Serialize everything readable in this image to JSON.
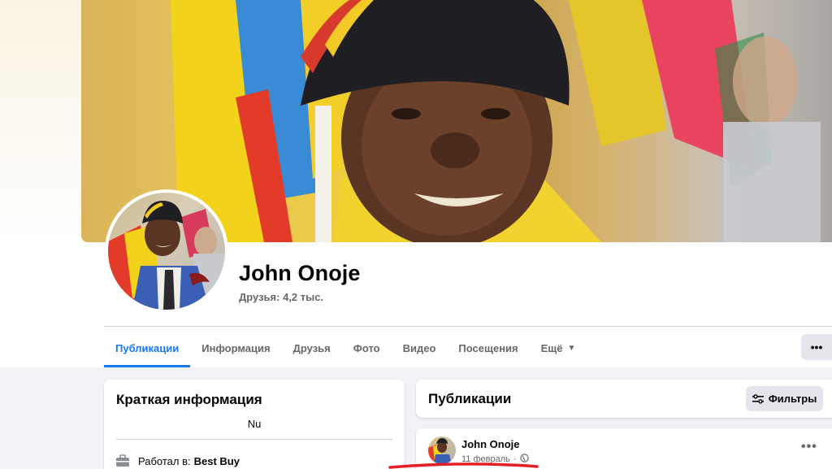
{
  "profile": {
    "name": "John Onoje",
    "friends": "Друзья: 4,2 тыс."
  },
  "tabs": [
    {
      "label": "Публикации",
      "active": true
    },
    {
      "label": "Информация"
    },
    {
      "label": "Друзья"
    },
    {
      "label": "Фото"
    },
    {
      "label": "Видео"
    },
    {
      "label": "Посещения"
    },
    {
      "label": "Ещё"
    }
  ],
  "more_button": "•••",
  "intro": {
    "title": "Краткая информация",
    "bio": "Nu",
    "work_prefix": "Работал в:",
    "work_company": "Best Buy"
  },
  "posts_header": {
    "title": "Публикации",
    "filter_label": "Фильтры"
  },
  "post": {
    "author": "John Onoje",
    "date": "11 февраль",
    "separator": "·",
    "more": "•••"
  },
  "colors": {
    "accent": "#1877f2",
    "background": "#f0f2f5",
    "annotation": "#e41e26"
  }
}
